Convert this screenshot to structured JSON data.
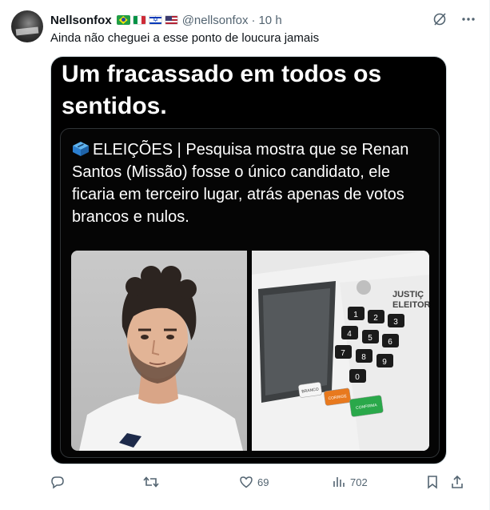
{
  "tweet": {
    "author_name": "Nellsonfox",
    "flags": [
      "brazil-flag",
      "italy-flag",
      "israel-flag",
      "usa-flag"
    ],
    "handle": "@nellsonfox",
    "separator": "·",
    "time": "10 h",
    "text": "Ainda não cheguei a esse ponto de loucura jamais"
  },
  "media": {
    "headline_lines": [
      "Um fracassado em todos os",
      "sentidos."
    ],
    "card_lines": [
      "ELEIÇÕES | Pesquisa mostra que se Renan",
      "Santos (Missão) fosse o único candidato, ele",
      "ficaria em terceiro lugar, atrás apenas de votos",
      "brancos e nulos."
    ],
    "urn_label_lines": [
      "JUSTIÇ",
      "ELEITORA"
    ],
    "urn_buttons": [
      "BRANCO",
      "CORRIGE",
      "CONFIRMA"
    ],
    "keypad_digits": [
      "1",
      "2",
      "3",
      "4",
      "5",
      "6",
      "7",
      "8",
      "9",
      "0"
    ]
  },
  "actions": {
    "reply_count": "",
    "retweet_count": "",
    "like_count": "69",
    "views_count": "702"
  },
  "colors": {
    "text_primary": "#0f1419",
    "text_secondary": "#536471",
    "media_bg": "#000000",
    "confirm_green": "#2aa84a",
    "correct_orange": "#e8791e"
  }
}
